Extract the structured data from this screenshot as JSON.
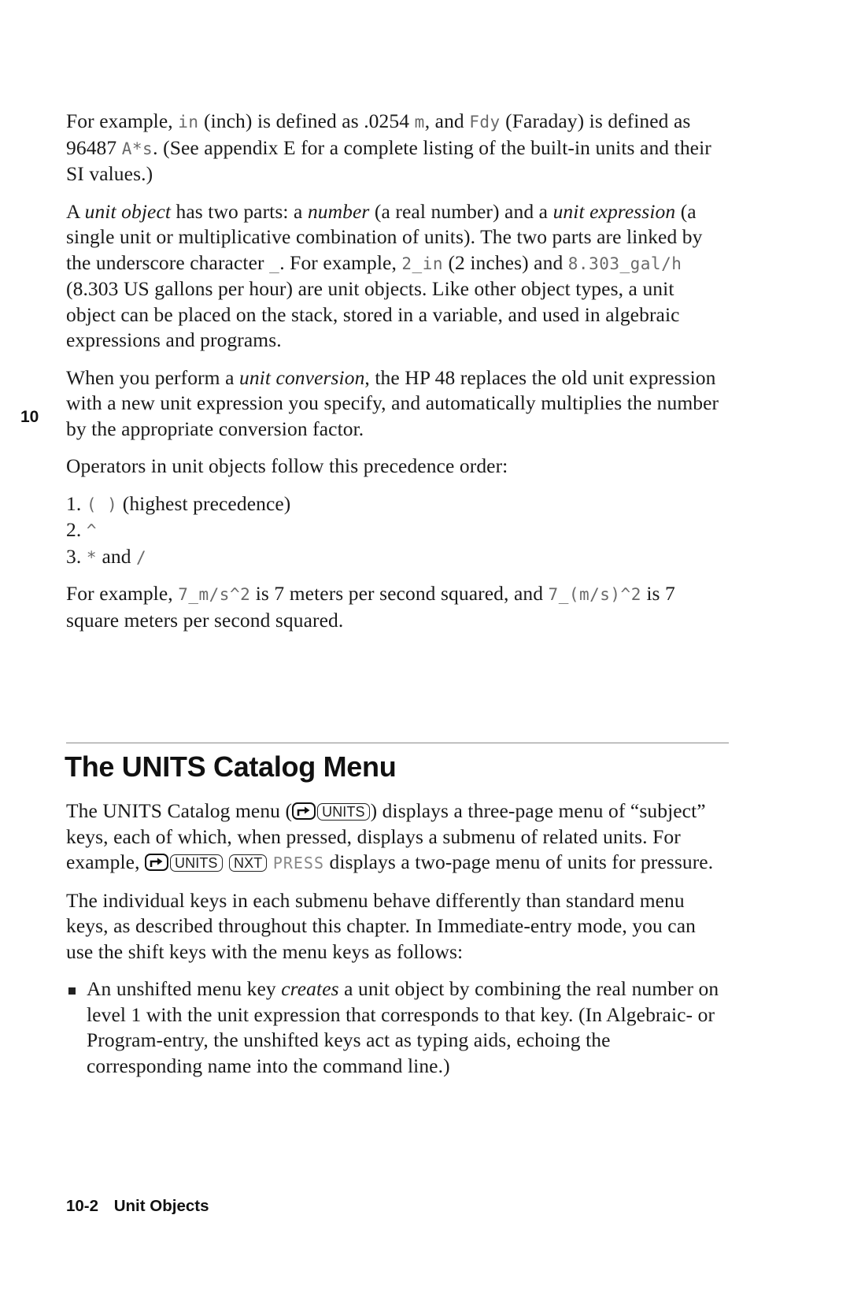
{
  "chapter_tab": "10",
  "intro": {
    "p1": {
      "t1": "For example, ",
      "c1": "in",
      "t2": " (inch) is defined as .0254 ",
      "c2": "m",
      "t3": ", and ",
      "c3": "Fdy",
      "t4": " (Faraday) is defined as 96487 ",
      "c4": "A*s",
      "t5": ". (See appendix E for a complete listing of the built-in units and their SI values.)"
    },
    "p2": {
      "t1": "A ",
      "e1": "unit object",
      "t2": " has two parts: a ",
      "e2": "number",
      "t3": " (a real number) and a ",
      "e3": "unit expression",
      "t4": " (a single unit or multiplicative combination of units). The two parts are linked by the underscore character ",
      "c1": "_",
      "t5": ". For example, ",
      "c2": "2_in",
      "t6": " (2 inches) and ",
      "c3": "8.303_gal/h",
      "t7": " (8.303 US gallons per hour) are unit objects. Like other object types, a unit object can be placed on the stack, stored in a variable, and used in algebraic expressions and programs."
    },
    "p3": {
      "t1": "When you perform a ",
      "e1": "unit conversion",
      "t2": ", the HP 48 replaces the old unit expression with a new unit expression you specify, and automatically multiplies the number by the appropriate conversion factor."
    },
    "p4": "Operators in unit objects follow this precedence order:",
    "precedence": [
      {
        "num": "1. ",
        "op": "( )",
        "note": " (highest precedence)"
      },
      {
        "num": "2. ",
        "op": "^",
        "note": ""
      },
      {
        "num": "3. ",
        "op": "*",
        "mid": " and ",
        "op2": "/"
      }
    ],
    "p5": {
      "t1": "For example, ",
      "c1": "7_m/s^2",
      "t2": " is 7 meters per second squared, and ",
      "c2": "7_(m/s)^2",
      "t3": " is 7 square meters per second squared."
    }
  },
  "section": {
    "heading": "The UNITS Catalog Menu",
    "p1": {
      "t1": "The UNITS Catalog menu (",
      "key_units": "UNITS",
      "t2": ") displays a three-page menu of “subject” keys, each of which, when pressed, displays a submenu of related units. For example, ",
      "key_units_2": "UNITS",
      "key_nxt": "NXT",
      "menu_press": "PRESS",
      "t3": " displays a two-page menu of units for pressure."
    },
    "p2": "The individual keys in each submenu behave differently than standard menu keys, as described throughout this chapter. In Immediate-entry mode, you can use the shift keys with the menu keys as follows:",
    "bullets": [
      {
        "t1": "An unshifted menu key ",
        "e1": "creates",
        "t2": " a unit object by combining the real number on level 1 with the unit expression that corresponds to that key. (In Algebraic- or Program-entry, the unshifted keys act as typing aids, echoing the corresponding name into the command line.)"
      }
    ]
  },
  "footer": {
    "page_number": "10-2",
    "chapter_title": "Unit Objects"
  }
}
